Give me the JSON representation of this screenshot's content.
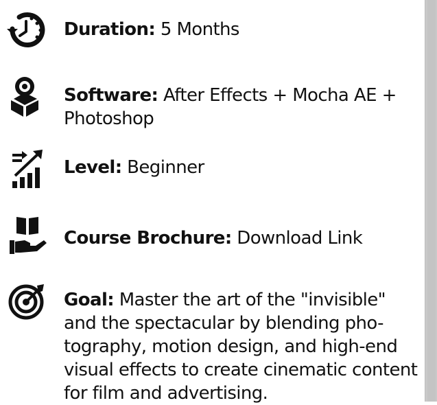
{
  "items": [
    {
      "icon": "clock-icon",
      "label": "Duration:",
      "value": " 5 Months"
    },
    {
      "icon": "cube-software-icon",
      "label": "Software:",
      "value": " After Effects + Mocha AE + Photoshop"
    },
    {
      "icon": "level-chart-icon",
      "label": "Level:",
      "value": " Beginner"
    },
    {
      "icon": "book-hand-icon",
      "label": "Course Brochure:",
      "value": " Download Link"
    },
    {
      "icon": "target-icon",
      "label": "Goal:",
      "value": " Master the art of the \"invisible\" and the spectacular by blending pho-tography, motion design, and high-end visual effects to create cinematic content for film and advertising."
    }
  ],
  "colors": {
    "text": "#111111",
    "background": "#ffffff",
    "scrollbar": "#c9c9c9"
  }
}
